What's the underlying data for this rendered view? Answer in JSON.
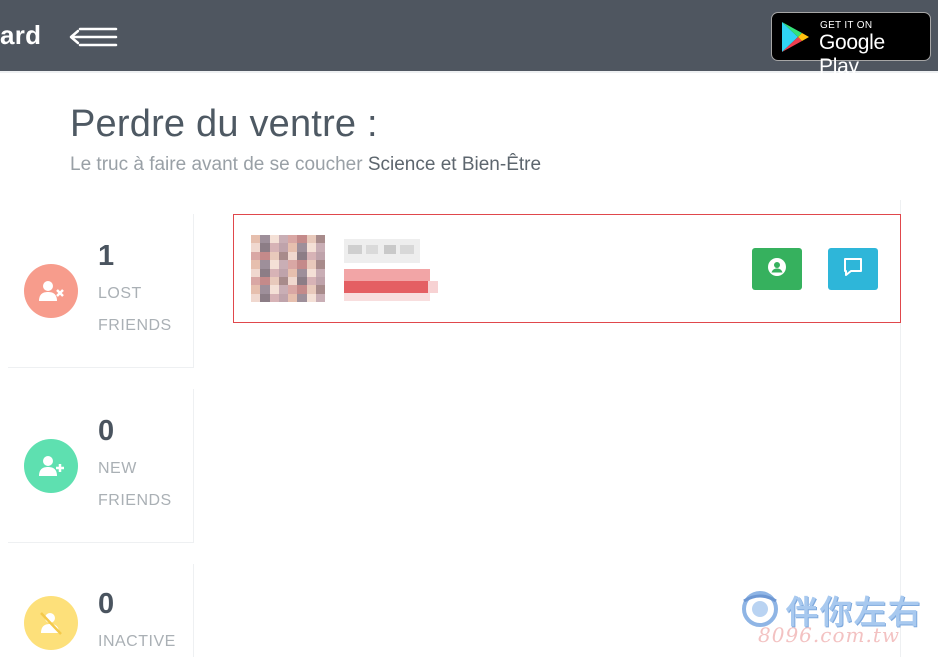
{
  "header": {
    "brand_text": "ard",
    "menu_icon": "menu-back-icon",
    "store_badge": {
      "small_text": "GET IT ON",
      "big_text": "Google Play",
      "icon": "google-play-icon"
    },
    "bg_color": "#4f5660"
  },
  "page": {
    "title": "Perdre du ventre :",
    "subtitle_prefix": "Le truc à faire avant de se coucher",
    "subtitle_category": "Science et Bien-Être"
  },
  "stats": [
    {
      "count": "1",
      "label_line1": "LOST",
      "label_line2": "FRIENDS",
      "icon": "user-remove-icon",
      "color": "#f79c8c"
    },
    {
      "count": "0",
      "label_line1": "NEW",
      "label_line2": "FRIENDS",
      "icon": "user-add-icon",
      "color": "#5ee0b0"
    },
    {
      "count": "0",
      "label_line1": "INACTIVE",
      "label_line2": "",
      "icon": "user-inactive-icon",
      "color": "#fde07a"
    }
  ],
  "friend_list": [
    {
      "avatar": "blurred-avatar",
      "name": "",
      "actions": {
        "profile_icon": "user-circle-icon",
        "message_icon": "chat-bubble-icon"
      }
    }
  ],
  "colors": {
    "highlight_border": "#e0474c",
    "profile_button": "#36b15e",
    "message_button": "#2eb6d9"
  },
  "watermark": {
    "text": "伴你左右",
    "sub": "8096.com.tw"
  }
}
